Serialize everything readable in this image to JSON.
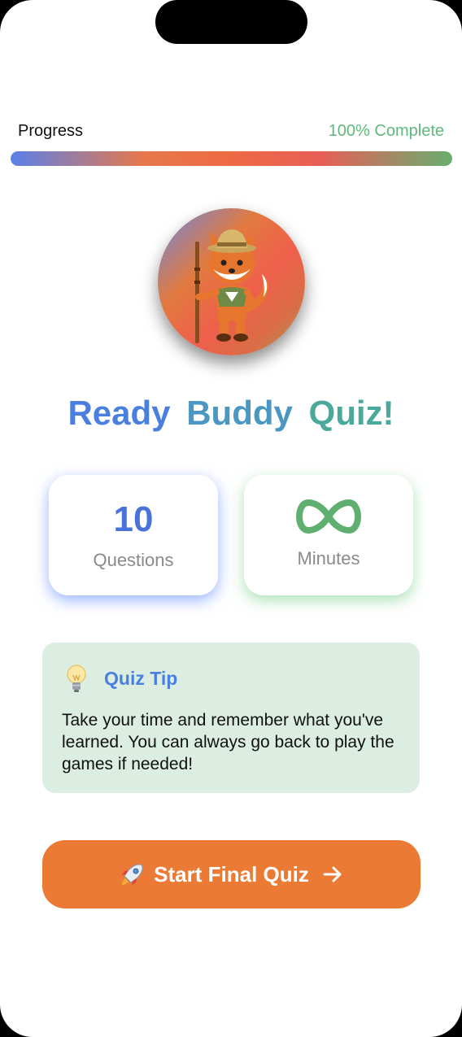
{
  "progress": {
    "label": "Progress",
    "value_text": "100% Complete",
    "percent": 100
  },
  "mascot": {
    "icon": "fox-explorer-mascot"
  },
  "title": {
    "word1": "Ready",
    "word2": "Buddy",
    "word3": "Quiz!"
  },
  "stats": {
    "questions": {
      "value": "10",
      "label": "Questions"
    },
    "minutes": {
      "icon": "infinity-icon",
      "label": "Minutes"
    }
  },
  "tip": {
    "icon": "lightbulb-icon",
    "title": "Quiz Tip",
    "text": "Take your time and remember what you've learned. You can always go back to play the games if needed!"
  },
  "start_button": {
    "label": "Start Final Quiz",
    "icons": [
      "rocket-icon",
      "arrow-right-icon"
    ]
  },
  "colors": {
    "accent_blue": "#4a7fe0",
    "accent_green": "#5fb87d",
    "button_orange": "#eb7a35",
    "tip_background": "#dcede2"
  }
}
